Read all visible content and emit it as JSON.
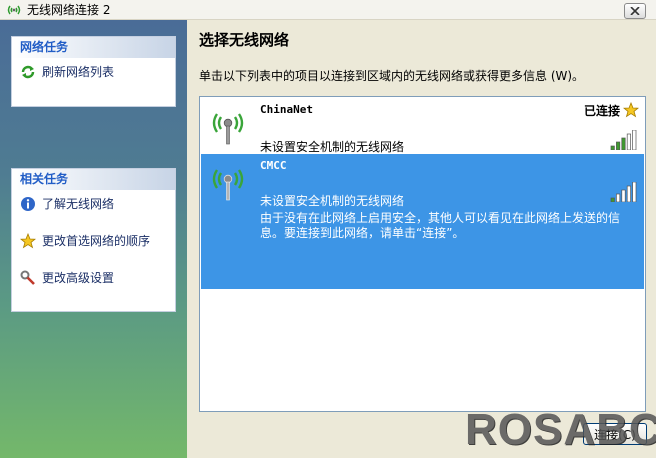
{
  "window": {
    "title": "无线网络连接 2",
    "icons": {
      "app": "wireless-network-icon",
      "close": "close-icon"
    }
  },
  "sidebar": {
    "network_tasks": {
      "header": "网络任务",
      "items": [
        {
          "label": "刷新网络列表",
          "icon": "refresh-icon"
        }
      ]
    },
    "related_tasks": {
      "header": "相关任务",
      "items": [
        {
          "label": "了解无线网络",
          "icon": "info-icon"
        },
        {
          "label": "更改首选网络的顺序",
          "icon": "star-icon"
        },
        {
          "label": "更改高级设置",
          "icon": "wrench-icon"
        }
      ]
    }
  },
  "main": {
    "title": "选择无线网络",
    "instruction": "单击以下列表中的项目以连接到区域内的无线网络或获得更多信息 (W)。",
    "networks": [
      {
        "ssid": "ChinaNet",
        "security": "未设置安全机制的无线网络",
        "status": "已连接",
        "signal_bars": 5,
        "signal_level": 0.6,
        "selected": false
      },
      {
        "ssid": "CMCC",
        "security": "未设置安全机制的无线网络",
        "description": "由于没有在此网络上启用安全，其他人可以看见在此网络上发送的信息。要连接到此网络，请单击“连接”。",
        "signal_bars": 5,
        "signal_level": 0.2,
        "selected": true
      }
    ],
    "connect_label": "连接(C)"
  },
  "watermark": "ROSABC",
  "colors": {
    "selection": "#3d95e6",
    "task_link": "#1b2f66",
    "task_header": "#215dc6",
    "signal_green": "#3f9b2f"
  }
}
